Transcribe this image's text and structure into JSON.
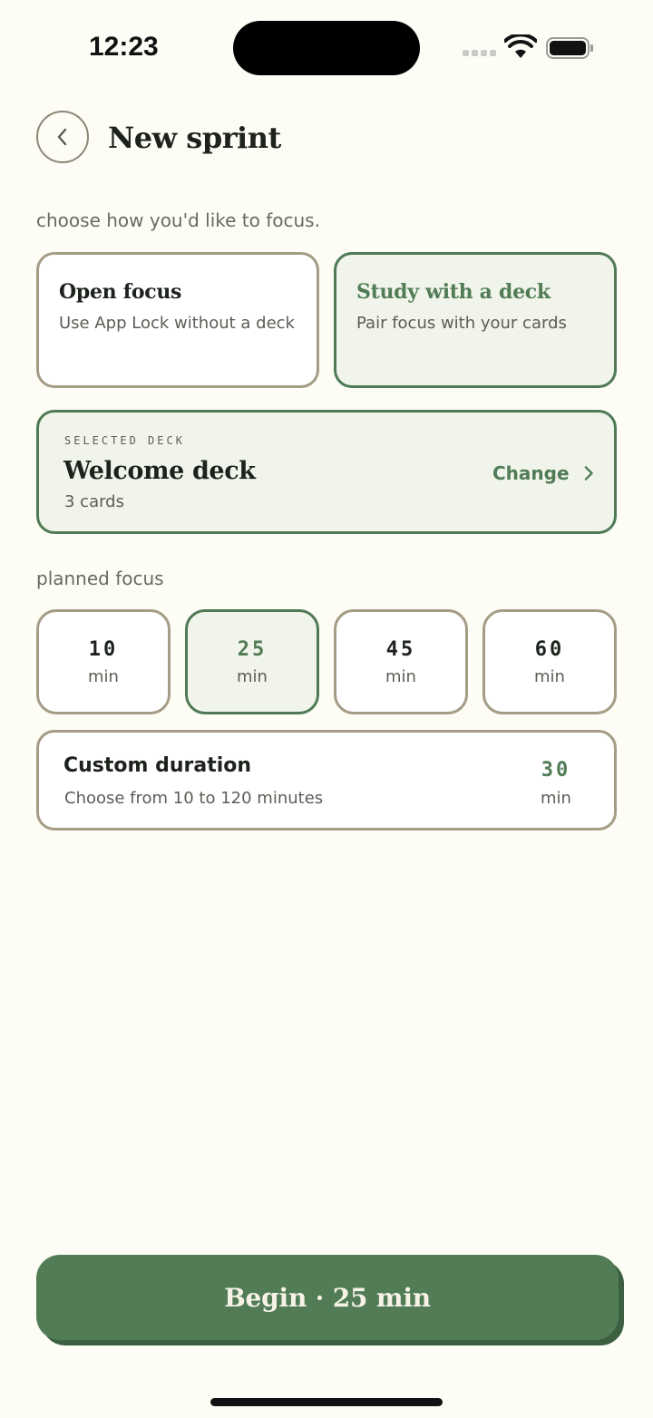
{
  "status_bar": {
    "time": "12:23",
    "icons": [
      "cellular-signal-icon",
      "wifi-icon",
      "battery-icon"
    ]
  },
  "header": {
    "back_icon": "chevron-left-icon",
    "title": "New sprint"
  },
  "mode_section": {
    "label": "choose how you'd like to focus.",
    "options": [
      {
        "title": "Open focus",
        "subtitle": "Use App Lock without a deck",
        "selected": false
      },
      {
        "title": "Study with a deck",
        "subtitle": "Pair focus with your cards",
        "selected": true
      }
    ]
  },
  "deck": {
    "eyebrow": "SELECTED DECK",
    "name": "Welcome deck",
    "count": "3 cards",
    "change_label": "Change",
    "change_icon": "chevron-right-icon"
  },
  "duration_section": {
    "label": "planned focus",
    "options": [
      {
        "value": "10",
        "unit": "min",
        "selected": false
      },
      {
        "value": "25",
        "unit": "min",
        "selected": true
      },
      {
        "value": "45",
        "unit": "min",
        "selected": false
      },
      {
        "value": "60",
        "unit": "min",
        "selected": false
      }
    ],
    "custom": {
      "title": "Custom duration",
      "subtitle": "Choose from 10 to 120 minutes",
      "value": "30",
      "unit": "min"
    }
  },
  "begin_button": {
    "label": "Begin · 25 min"
  },
  "colors": {
    "background": "#fdfcf5",
    "accent": "#517c56",
    "selected_fill": "#f0f4ea",
    "border": "#a59c86"
  }
}
